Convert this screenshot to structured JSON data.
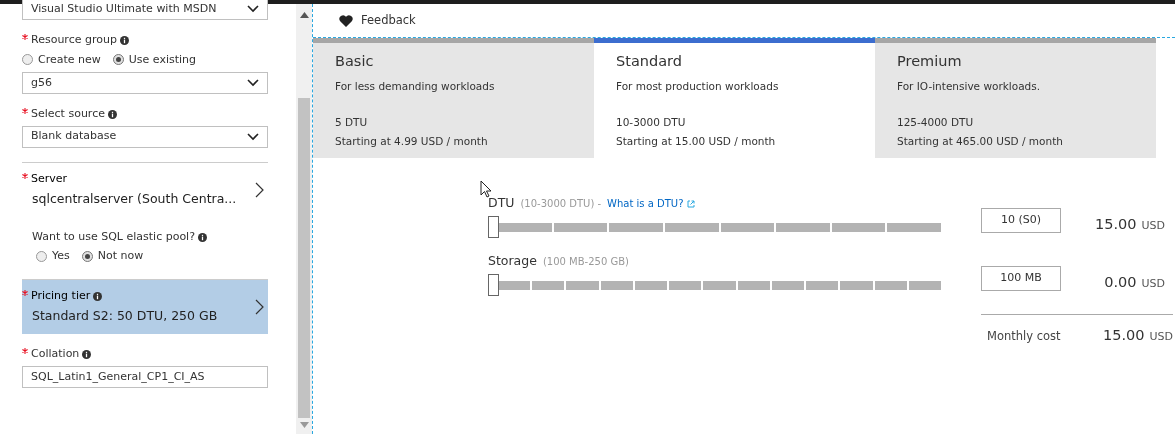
{
  "form": {
    "fields": [
      {
        "kind": "select",
        "value": "Visual Studio Ultimate with MSDN"
      },
      {
        "kind": "radio-select",
        "label": "Resource group",
        "required": true,
        "info": true,
        "options": [
          {
            "label": "Create new",
            "selected": false
          },
          {
            "label": "Use existing",
            "selected": true
          }
        ],
        "dropdown": {
          "value": "g56"
        }
      },
      {
        "kind": "select",
        "label": "Select source",
        "required": true,
        "info": true,
        "value": "Blank database"
      },
      {
        "kind": "blade",
        "label": "Server",
        "required": true,
        "value": "sqlcentralserver (South Centra...",
        "selected": false
      },
      {
        "kind": "radio",
        "label": "Want to use SQL elastic pool?",
        "info": true,
        "options": [
          {
            "label": "Yes",
            "selected": false
          },
          {
            "label": "Not now",
            "selected": true
          }
        ]
      },
      {
        "kind": "blade",
        "label": "Pricing tier",
        "required": true,
        "info": true,
        "value": "Standard S2: 50 DTU, 250 GB",
        "selected": true
      },
      {
        "kind": "input",
        "label": "Collation",
        "required": true,
        "info": true,
        "value": "SQL_Latin1_General_CP1_CI_AS"
      }
    ]
  },
  "toolbar": {
    "feedback": "Feedback"
  },
  "tiers": [
    {
      "name": "Basic",
      "description": "For less demanding workloads",
      "dtu": "5 DTU",
      "price": "Starting at 4.99 USD / month",
      "selected": false
    },
    {
      "name": "Standard",
      "description": "For most production workloads",
      "dtu": "10-3000 DTU",
      "price": "Starting at 15.00 USD / month",
      "selected": true
    },
    {
      "name": "Premium",
      "description": "For IO-intensive workloads.",
      "dtu": "125-4000 DTU",
      "price": "Starting at 465.00 USD / month",
      "selected": false
    }
  ],
  "sliders": [
    {
      "label": "DTU",
      "range": "(10-3000 DTU) -",
      "link": "What is a DTU?",
      "level": 0,
      "value": "10 (S0)",
      "cost": "15.00",
      "currency": "USD"
    },
    {
      "label": "Storage",
      "range": "(100 MB-250 GB)",
      "level": 0,
      "value": "100 MB",
      "cost": "0.00",
      "currency": "USD"
    }
  ],
  "total": {
    "label": "Monthly cost",
    "cost": "15.00",
    "currency": "USD"
  }
}
